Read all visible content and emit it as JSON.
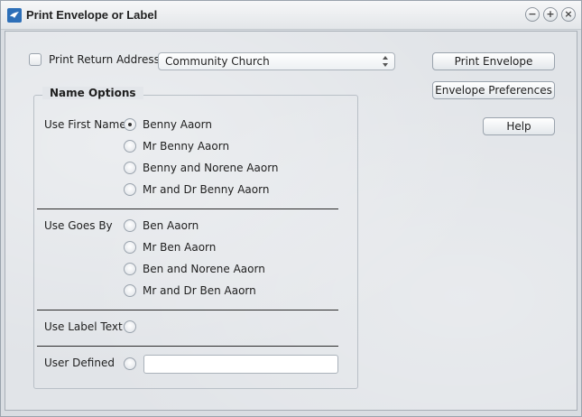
{
  "window": {
    "title": "Print Envelope or Label",
    "app_icon": "dove-icon",
    "controls": [
      "minimize-icon",
      "maximize-icon",
      "close-icon"
    ]
  },
  "return_address": {
    "label": "Print Return Address",
    "checked": false,
    "select_value": "Community Church"
  },
  "buttons": {
    "print_envelope": "Print Envelope",
    "envelope_preferences": "Envelope Preferences",
    "help": "Help"
  },
  "name_options": {
    "legend": "Name Options",
    "use_first_name": {
      "label": "Use First Name",
      "options": [
        "Benny Aaorn",
        "Mr Benny Aaorn",
        "Benny and Norene Aaorn",
        "Mr and Dr Benny Aaorn"
      ],
      "selected_index": 0
    },
    "use_goes_by": {
      "label": "Use Goes By",
      "options": [
        "Ben Aaorn",
        "Mr Ben Aaorn",
        "Ben and Norene Aaorn",
        "Mr and Dr Ben Aaorn"
      ]
    },
    "use_label_text": {
      "label": "Use Label Text"
    },
    "user_defined": {
      "label": "User Defined",
      "value": ""
    }
  }
}
